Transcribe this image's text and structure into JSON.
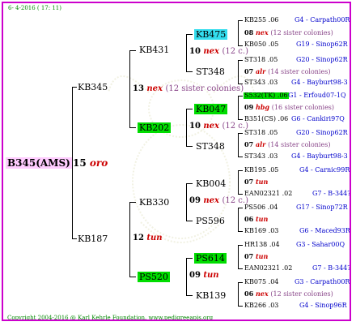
{
  "header": {
    "date_label": "6- 4-2016 ( 17: 11)"
  },
  "footer": {
    "copyright": "Copyright 2004-2016 @ Karl Kehrle Foundation.   www.pedigreeapis.org"
  },
  "root": {
    "name": "B345(AMS)",
    "year": "15",
    "race": "oro"
  },
  "gen1": [
    {
      "name": "KB345",
      "year": "13",
      "race": "nex",
      "note": "(12 sister colonies)"
    },
    {
      "name": "KB187",
      "year": "12",
      "race": "tun"
    }
  ],
  "gen2": [
    {
      "name": "KB431",
      "year": "10",
      "race": "nex",
      "note": "(12 c.)"
    },
    {
      "name": "KB202",
      "year": "10",
      "race": "nex",
      "note": "(12 c.)"
    },
    {
      "name": "KB330",
      "year": "09",
      "race": "nex",
      "note": "(12 c.)"
    },
    {
      "name": "PS520",
      "year": "09",
      "race": "tun"
    }
  ],
  "gen3": [
    {
      "name": "KB475"
    },
    {
      "name": "ST348"
    },
    {
      "name": "KB047"
    },
    {
      "name": "ST348"
    },
    {
      "name": "KB004"
    },
    {
      "name": "PS596"
    },
    {
      "name": "PS614"
    },
    {
      "name": "KB139"
    }
  ],
  "gen4": [
    {
      "top": "KB255 .06",
      "top_src": "G4 - Carpath00R",
      "year": "08",
      "race": "nex",
      "note": "(12 sister colonies)",
      "bottom": "KB050 .05",
      "bottom_src": "G19 - Sinop62R"
    },
    {
      "top": "ST318 .05",
      "top_src": "G20 - Sinop62R",
      "year": "07",
      "race": "alr",
      "note": "(14 sister colonies)",
      "bottom": "ST343 .03",
      "bottom_src": "G4 - Bayburt98-3"
    },
    {
      "top": "S532(TK) .06",
      "top_src": "G1 - Erfoud07-1Q",
      "year": "09",
      "race": "hbg",
      "note": "(16 sister colonies)",
      "bottom": "B351(CS) .06",
      "bottom_src": "G6 - Cankiri97Q"
    },
    {
      "top": "ST318 .05",
      "top_src": "G20 - Sinop62R",
      "year": "07",
      "race": "alr",
      "note": "(14 sister colonies)",
      "bottom": "ST343 .03",
      "bottom_src": "G4 - Bayburt98-3"
    },
    {
      "top": "KB195 .05",
      "top_src": "G4 - Carnic99R",
      "year": "07",
      "race": "tun",
      "note": "",
      "bottom": "EAN02321 .02",
      "bottom_src": "G7 - B-344?"
    },
    {
      "top": "PS506 .04",
      "top_src": "G17 - Sinop72R",
      "year": "06",
      "race": "tun",
      "note": "",
      "bottom": "KB169 .03",
      "bottom_src": "G6 - Maced93R"
    },
    {
      "top": "HR138 .04",
      "top_src": "G3 - Sahar00Q",
      "year": "07",
      "race": "tun",
      "note": "",
      "bottom": "EAN02321 .02",
      "bottom_src": "G7 - B-344?"
    },
    {
      "top": "KB075 .04",
      "top_src": "G3 - Carpath00R",
      "year": "06",
      "race": "nex",
      "note": "(12 sister colonies)",
      "bottom": "KB266 .03",
      "bottom_src": "G4 - Sinop96R"
    }
  ]
}
